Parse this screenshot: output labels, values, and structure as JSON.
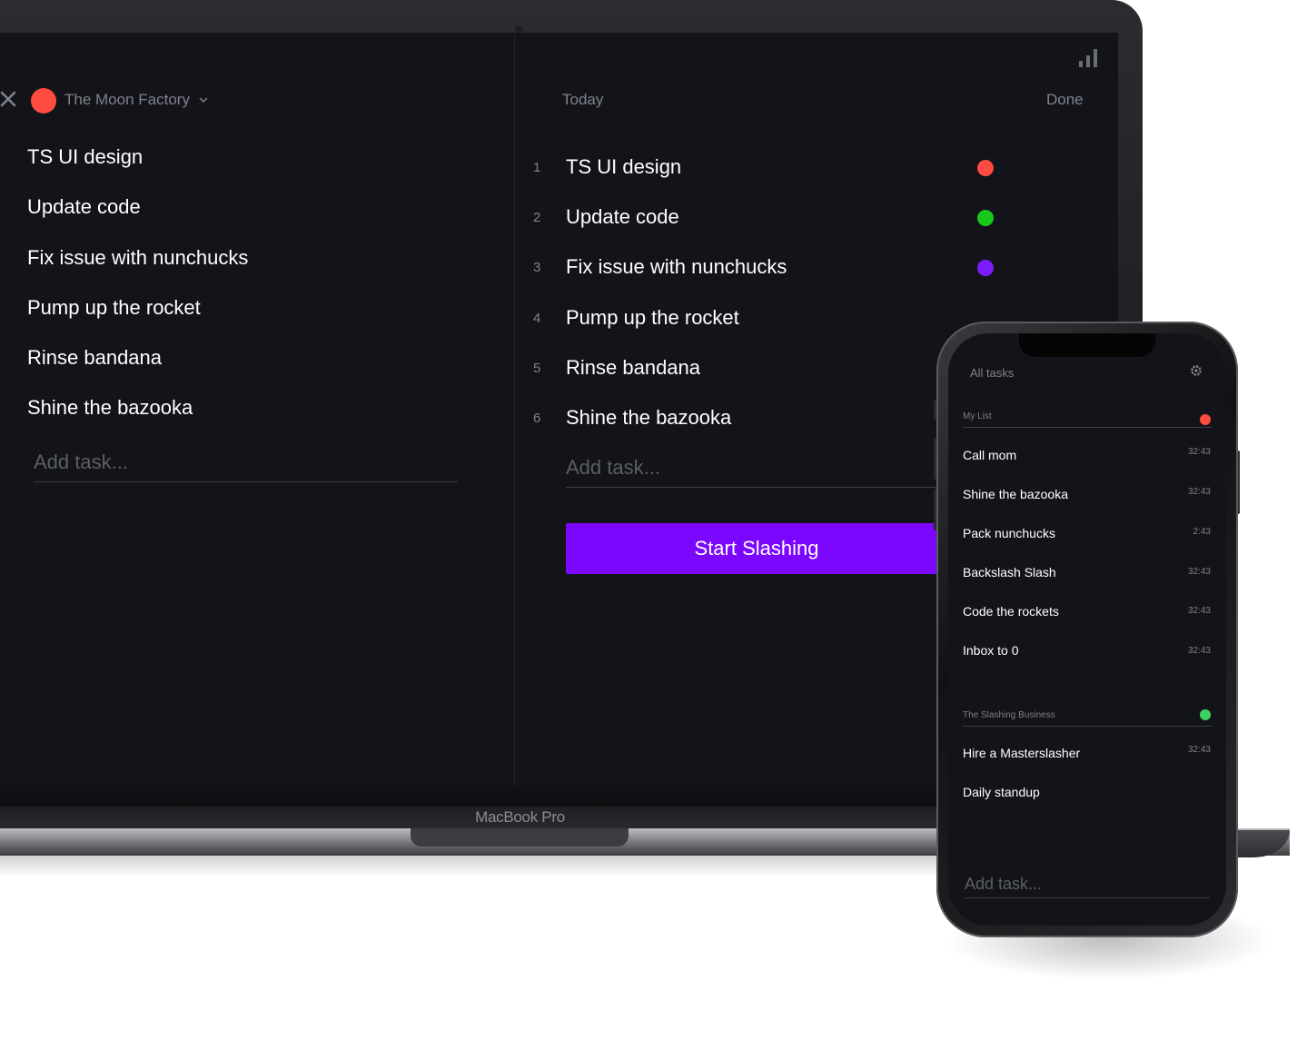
{
  "colors": {
    "accent": "#7c07ff",
    "red": "#ff4b40",
    "green": "#18c71b",
    "purple": "#7b1bff",
    "light_green": "#3ed160",
    "screen_bg": "#131419"
  },
  "laptop": {
    "brand": "MacBook Pro",
    "left_pane": {
      "project_name": "The Moon Factory",
      "project_color": "red",
      "tasks": [
        "TS UI design",
        "Update code",
        "Fix issue with nunchucks",
        "Pump up the rocket",
        "Rinse bandana",
        "Shine the bazooka"
      ],
      "add_placeholder": "Add task..."
    },
    "right_pane": {
      "today_label": "Today",
      "done_label": "Done",
      "tasks": [
        {
          "num": "1",
          "label": "TS UI design",
          "dot": "red"
        },
        {
          "num": "2",
          "label": "Update code",
          "dot": "green"
        },
        {
          "num": "3",
          "label": "Fix issue with nunchucks",
          "dot": "purple"
        },
        {
          "num": "4",
          "label": "Pump up the rocket"
        },
        {
          "num": "5",
          "label": "Rinse bandana"
        },
        {
          "num": "6",
          "label": "Shine the bazooka"
        }
      ],
      "add_placeholder": "Add task...",
      "start_button": "Start Slashing"
    }
  },
  "phone": {
    "title": "All tasks",
    "sections": [
      {
        "name": "My List",
        "dot": "red",
        "tasks": [
          {
            "label": "Call mom",
            "time": "32:43"
          },
          {
            "label": "Shine the bazooka",
            "time": "32:43"
          },
          {
            "label": "Pack nunchucks",
            "time": "2:43"
          },
          {
            "label": "Backslash Slash",
            "time": "32:43"
          },
          {
            "label": "Code the rockets",
            "time": "32:43"
          },
          {
            "label": "Inbox to 0",
            "time": "32:43"
          }
        ]
      },
      {
        "name": "The Slashing Business",
        "dot": "light_green",
        "tasks": [
          {
            "label": "Hire a Masterslasher",
            "time": "32:43"
          },
          {
            "label": "Daily standup",
            "time": ""
          }
        ]
      }
    ],
    "add_placeholder": "Add task..."
  }
}
